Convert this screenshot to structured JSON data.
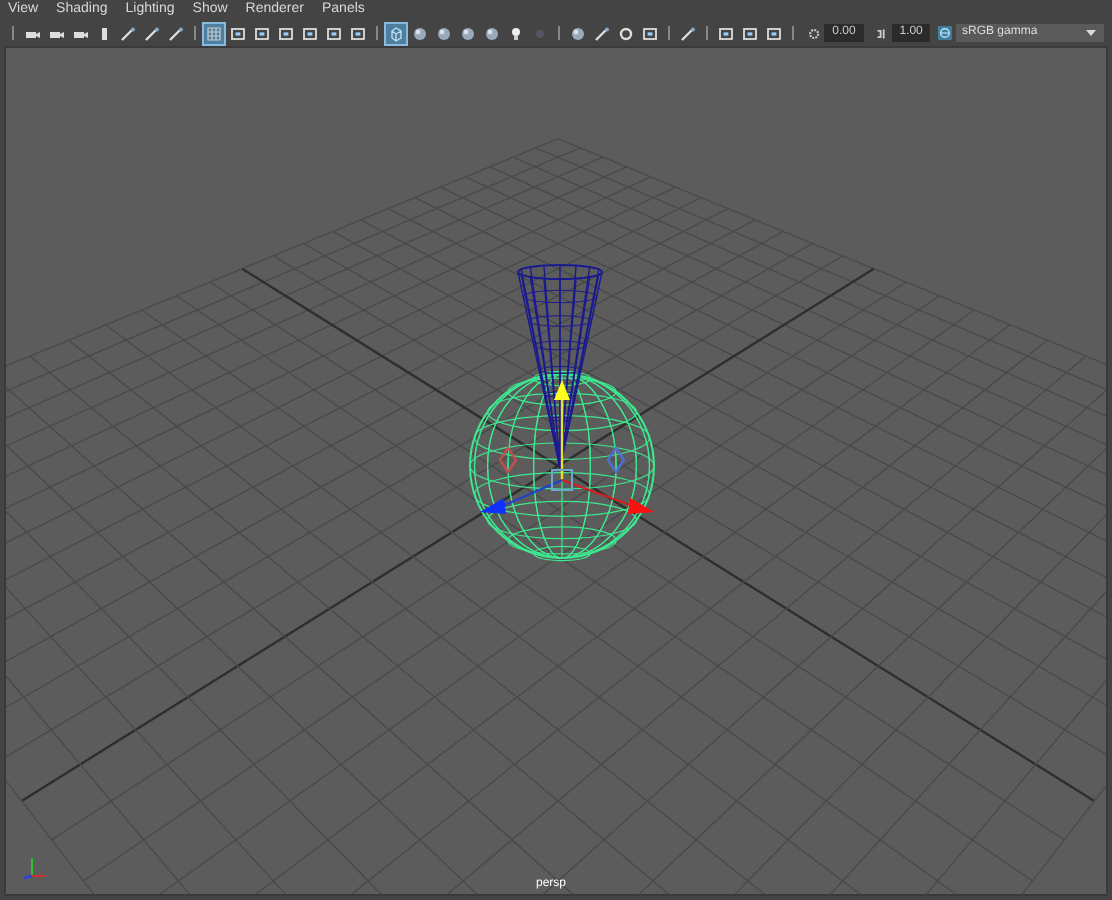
{
  "menu": [
    "View",
    "Shading",
    "Lighting",
    "Show",
    "Renderer",
    "Panels"
  ],
  "toolbar_groups": [
    {
      "items": [
        {
          "kind": "camera",
          "selected": false
        },
        {
          "kind": "camera",
          "selected": false
        },
        {
          "kind": "camera",
          "selected": false
        },
        {
          "kind": "bar",
          "selected": false
        },
        {
          "kind": "pen",
          "selected": false
        },
        {
          "kind": "pen",
          "selected": false
        },
        {
          "kind": "pen",
          "selected": false
        }
      ]
    },
    {
      "items": [
        {
          "kind": "grid",
          "selected": true
        },
        {
          "kind": "rect",
          "selected": false
        },
        {
          "kind": "rect",
          "selected": false
        },
        {
          "kind": "rect",
          "selected": false
        },
        {
          "kind": "rect",
          "selected": false
        },
        {
          "kind": "rect",
          "selected": false
        },
        {
          "kind": "rect",
          "selected": false
        }
      ]
    },
    {
      "items": [
        {
          "kind": "cube",
          "selected": true
        },
        {
          "kind": "sphere",
          "selected": false
        },
        {
          "kind": "sphere",
          "selected": false
        },
        {
          "kind": "sphere",
          "selected": false
        },
        {
          "kind": "sphere",
          "selected": false
        },
        {
          "kind": "bulb",
          "selected": false
        },
        {
          "kind": "dot",
          "selected": false
        }
      ]
    },
    {
      "items": [
        {
          "kind": "sphere",
          "selected": false
        },
        {
          "kind": "pen",
          "selected": false
        },
        {
          "kind": "ring",
          "selected": false
        },
        {
          "kind": "rect",
          "selected": false
        }
      ]
    },
    {
      "items": [
        {
          "kind": "pen",
          "selected": false
        }
      ]
    },
    {
      "items": [
        {
          "kind": "rect",
          "selected": false
        },
        {
          "kind": "rect",
          "selected": false
        },
        {
          "kind": "rect",
          "selected": false
        }
      ]
    }
  ],
  "exposure": {
    "value": "0.00"
  },
  "gamma": {
    "value": "1.00"
  },
  "color_space": {
    "value": "sRGB gamma"
  },
  "camera_label": "persp"
}
